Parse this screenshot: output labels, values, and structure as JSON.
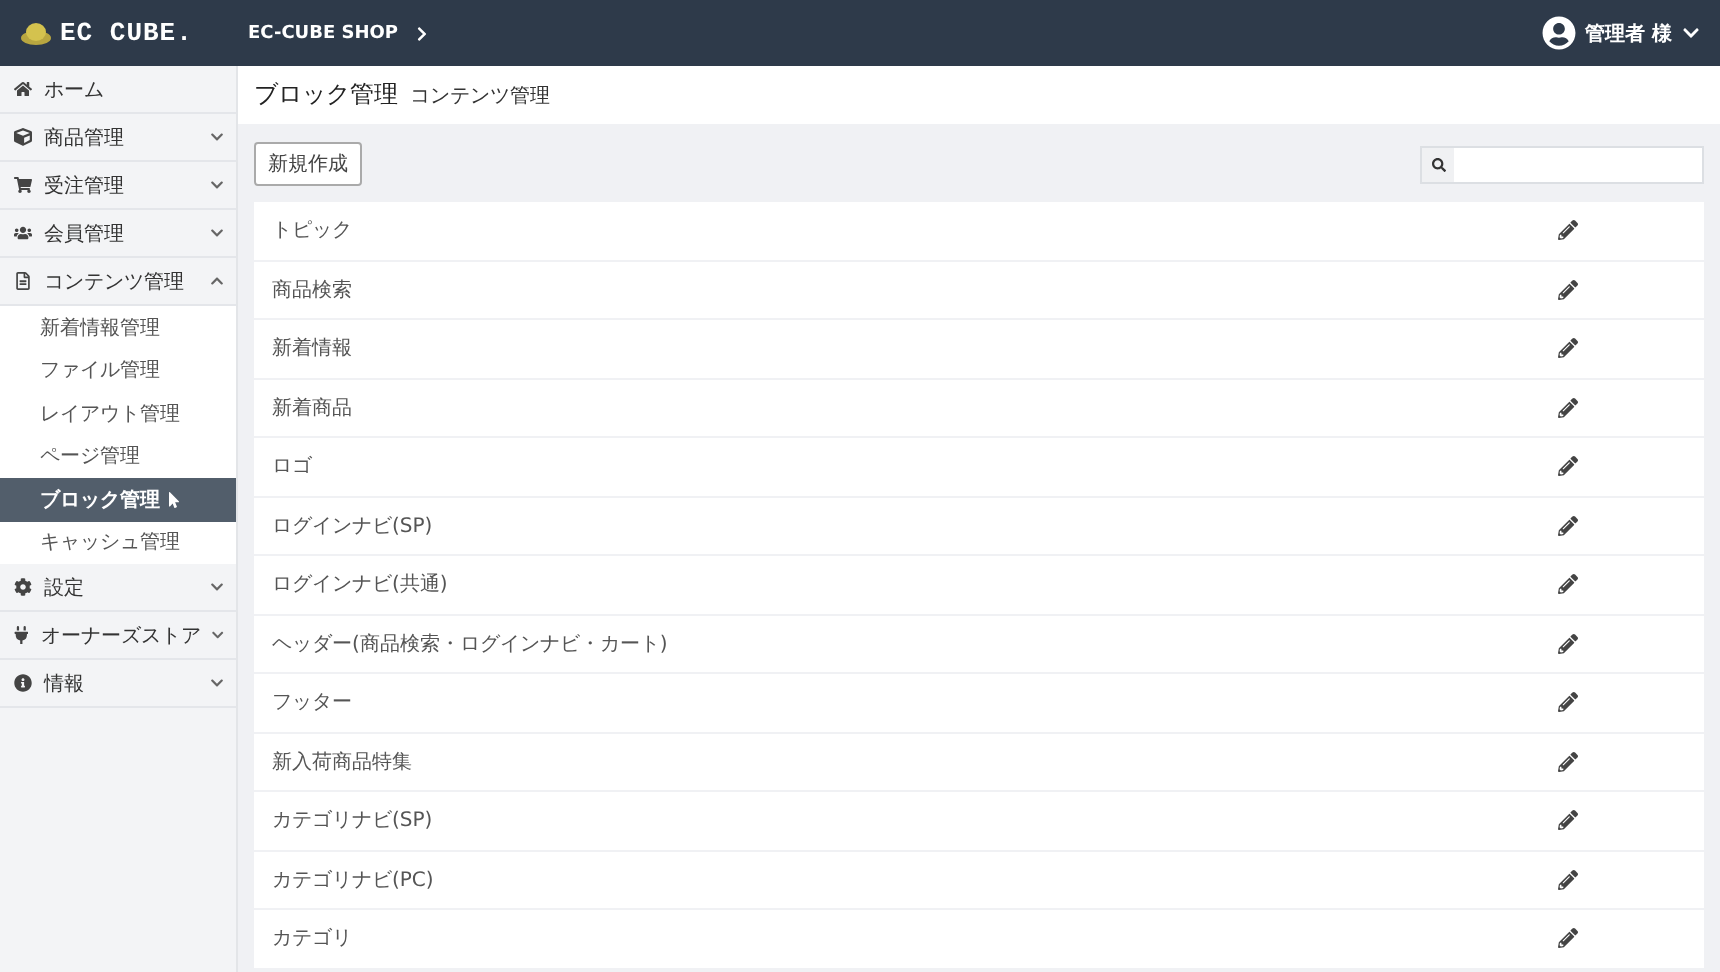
{
  "header": {
    "logo": "EC CUBE.",
    "shop": "EC-CUBE SHOP",
    "user": "管理者 様"
  },
  "sidebar": {
    "items": [
      {
        "label": "ホーム"
      },
      {
        "label": "商品管理",
        "expanded": false
      },
      {
        "label": "受注管理",
        "expanded": false
      },
      {
        "label": "会員管理",
        "expanded": false
      },
      {
        "label": "コンテンツ管理",
        "expanded": true,
        "children": [
          {
            "label": "新着情報管理",
            "selected": false
          },
          {
            "label": "ファイル管理",
            "selected": false
          },
          {
            "label": "レイアウト管理",
            "selected": false
          },
          {
            "label": "ページ管理",
            "selected": false
          },
          {
            "label": "ブロック管理",
            "selected": true
          },
          {
            "label": "キャッシュ管理",
            "selected": false
          }
        ]
      },
      {
        "label": "設定",
        "expanded": false
      },
      {
        "label": "オーナーズストア",
        "expanded": false
      },
      {
        "label": "情報",
        "expanded": false
      }
    ]
  },
  "page": {
    "title": "ブロック管理",
    "subtitle": "コンテンツ管理"
  },
  "toolbar": {
    "new_button": "新規作成"
  },
  "blocks": [
    {
      "name": "トピック"
    },
    {
      "name": "商品検索"
    },
    {
      "name": "新着情報"
    },
    {
      "name": "新着商品"
    },
    {
      "name": "ロゴ"
    },
    {
      "name": "ログインナビ(SP)"
    },
    {
      "name": "ログインナビ(共通)"
    },
    {
      "name": "ヘッダー(商品検索・ログインナビ・カート)"
    },
    {
      "name": "フッター"
    },
    {
      "name": "新入荷商品特集"
    },
    {
      "name": "カテゴリナビ(SP)"
    },
    {
      "name": "カテゴリナビ(PC)"
    },
    {
      "name": "カテゴリ"
    }
  ]
}
